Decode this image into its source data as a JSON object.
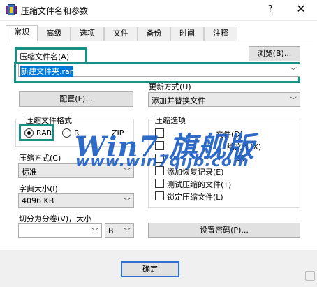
{
  "window": {
    "title": "压缩文件名和参数",
    "help_label": "?",
    "close_label": "✕",
    "icon": "winrar-books-icon"
  },
  "tabs": [
    "常规",
    "高级",
    "选项",
    "文件",
    "备份",
    "时间",
    "注释"
  ],
  "archive_name": {
    "label": "压缩文件名(A)",
    "browse_label": "浏览(B)...",
    "value": "新建文件夹.rar"
  },
  "update_mode": {
    "label": "更新方式(U)",
    "value": "添加并替换文件"
  },
  "profiles_label": "配置(F)...",
  "format": {
    "label": "压缩文件格式",
    "options": [
      "RAR",
      "RAR4",
      "ZIP"
    ],
    "selected": "RAR",
    "visible_text": {
      "rar": "RAR",
      "rar4": "R",
      "zip": "ZIP"
    }
  },
  "method": {
    "label": "压缩方式(C)",
    "value": "标准"
  },
  "dictionary": {
    "label": "字典大小(I)",
    "value": "4096 KB"
  },
  "split": {
    "label": "切分为分卷(V)，大小",
    "value": "",
    "unit": "B"
  },
  "options": {
    "label": "压缩选项",
    "items": [
      {
        "label": "文件(D)",
        "checked": false
      },
      {
        "label": "缩文件(X)",
        "checked": false
      },
      {
        "label": "(S)",
        "checked": false
      },
      {
        "label": "添加恢复记录(E)",
        "checked": false
      },
      {
        "label": "测试压缩的文件(T)",
        "checked": false
      },
      {
        "label": "锁定压缩文件(L)",
        "checked": false
      }
    ]
  },
  "password_label": "设置密码(P)...",
  "ok_label": "确定",
  "watermark": {
    "brand": "Win7 旗舰版",
    "url": "www.win7qijb.com"
  }
}
